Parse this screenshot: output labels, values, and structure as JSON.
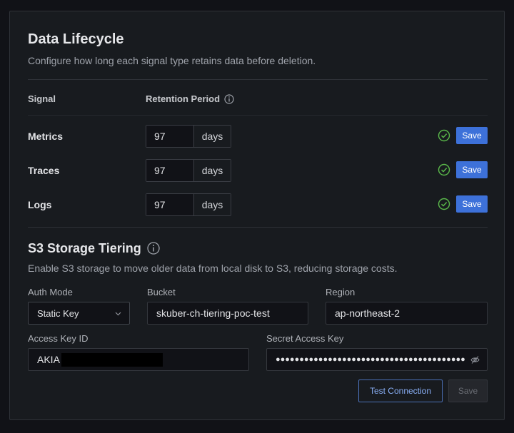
{
  "lifecycle": {
    "title": "Data Lifecycle",
    "subtitle": "Configure how long each signal type retains data before deletion.",
    "col_signal": "Signal",
    "col_retention": "Retention Period",
    "rows": [
      {
        "label": "Metrics",
        "value": "97",
        "unit": "days",
        "save": "Save"
      },
      {
        "label": "Traces",
        "value": "97",
        "unit": "days",
        "save": "Save"
      },
      {
        "label": "Logs",
        "value": "97",
        "unit": "days",
        "save": "Save"
      }
    ]
  },
  "s3": {
    "title": "S3 Storage Tiering",
    "description": "Enable S3 storage to move older data from local disk to S3, reducing storage costs.",
    "auth_mode_label": "Auth Mode",
    "auth_mode_value": "Static Key",
    "bucket_label": "Bucket",
    "bucket_value": "skuber-ch-tiering-poc-test",
    "region_label": "Region",
    "region_value": "ap-northeast-2",
    "access_key_label": "Access Key ID",
    "access_key_value": "AKIA",
    "secret_key_label": "Secret Access Key",
    "secret_key_masked": "●●●●●●●●●●●●●●●●●●●●●●●●●●●●●●●●●●●●●●●●",
    "test_button": "Test Connection",
    "save_button": "Save"
  },
  "colors": {
    "primary": "#3d71d9",
    "success": "#5ab84a",
    "background": "#181b1f"
  },
  "icons": [
    "info-icon",
    "check-circle-icon",
    "chevron-down-icon",
    "eye-slash-icon"
  ]
}
